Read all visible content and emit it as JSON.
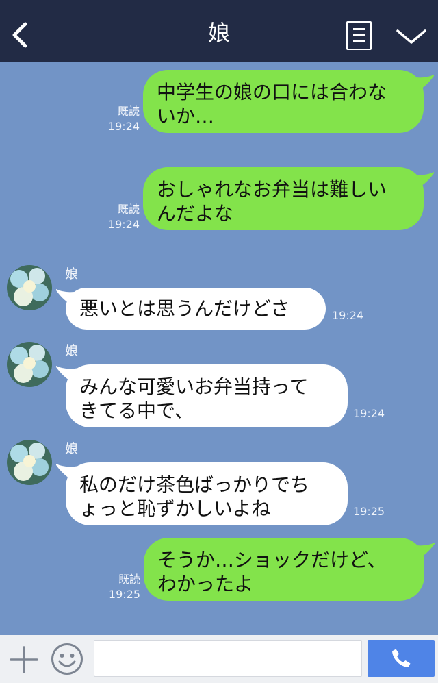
{
  "header": {
    "title": "娘",
    "back_icon": "chevron-left-icon",
    "menu_icon": "note-icon",
    "collapse_icon": "chevron-down-icon"
  },
  "messages": [
    {
      "side": "out",
      "lines": [
        "中学生の娘の口には合わな",
        "いか…"
      ],
      "read": "既読",
      "time": "19:24"
    },
    {
      "side": "out",
      "lines": [
        "おしゃれなお弁当は難しい",
        "んだよな"
      ],
      "read": "既読",
      "time": "19:24"
    },
    {
      "side": "in",
      "sender": "娘",
      "lines": [
        "悪いとは思うんだけどさ"
      ],
      "time": "19:24"
    },
    {
      "side": "in",
      "sender": "娘",
      "lines": [
        "みんな可愛いお弁当持って",
        "きてる中で、"
      ],
      "time": "19:24"
    },
    {
      "side": "in",
      "sender": "娘",
      "lines": [
        "私のだけ茶色ばっかりでち",
        "ょっと恥ずかしいよね"
      ],
      "time": "19:25"
    },
    {
      "side": "out",
      "lines": [
        "そうか…ショックだけど、",
        "わかったよ"
      ],
      "read": "既読",
      "time": "19:25"
    }
  ],
  "input_bar": {
    "plus_icon": "plus-icon",
    "emoji_icon": "smile-icon",
    "input_value": "",
    "send_icon": "phone-icon"
  },
  "colors": {
    "header_bg": "#222b45",
    "chat_bg": "#7294c6",
    "outgoing_bubble": "#83e34b",
    "incoming_bubble": "#ffffff",
    "send_button": "#4f84e7"
  }
}
